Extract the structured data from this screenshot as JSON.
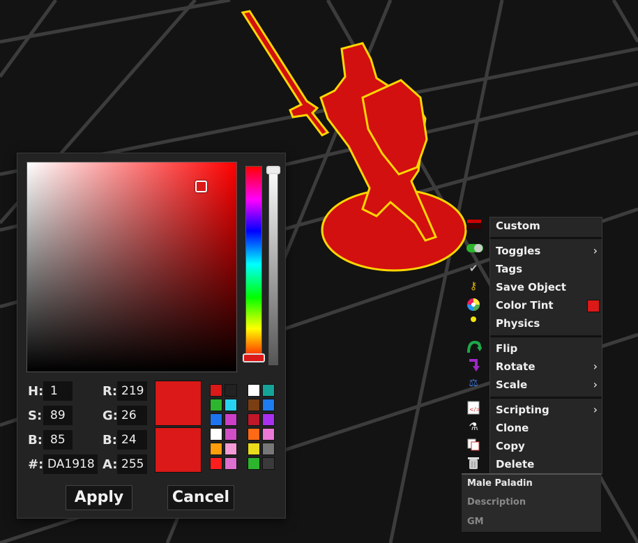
{
  "color_picker": {
    "hsb": {
      "h_label": "H:",
      "h": "1",
      "s_label": "S:",
      "s": "89",
      "b_label": "B:",
      "b": "85"
    },
    "rgb": {
      "r_label": "R:",
      "r": "219",
      "g_label": "G:",
      "g": "26",
      "b_label": "B:",
      "b": "24"
    },
    "hex_label": "#:",
    "hex": "DA1918",
    "alpha_label": "A:",
    "alpha": "255",
    "current_color": "#da1918",
    "apply_label": "Apply",
    "cancel_label": "Cancel",
    "palette_left": [
      "#da1918",
      "#222222",
      "#2db52d",
      "#28d3f0",
      "#1e74ee",
      "#cc3fc8",
      "#ffffff",
      "#d04fc6",
      "#ff9e0c",
      "#f49ad6",
      "#ff1d1d",
      "#dd6fce"
    ],
    "palette_right": [
      "#ffffff",
      "#15a49a",
      "#7b3e13",
      "#1e7bf0",
      "#c0172a",
      "#a930ef",
      "#ff6a17",
      "#ec79d7",
      "#e9dc1d",
      "#777777",
      "#2db52d",
      "#3a3a3a"
    ]
  },
  "context_menu": {
    "items": [
      {
        "label": "Custom",
        "icon": "custom-color-icon"
      },
      {
        "label": "Toggles",
        "icon": "toggle-icon",
        "submenu": true
      },
      {
        "label": "Tags",
        "icon": "check-icon"
      },
      {
        "label": "Save Object",
        "icon": "key-icon"
      },
      {
        "label": "Color Tint",
        "icon": "color-wheel-icon",
        "swatch": "#da1918"
      },
      {
        "label": "Physics",
        "icon": "physics-dot-icon"
      },
      {
        "label": "Flip",
        "icon": "flip-arrow-icon"
      },
      {
        "label": "Rotate",
        "icon": "rotate-arrow-icon",
        "submenu": true
      },
      {
        "label": "Scale",
        "icon": "scale-icon",
        "submenu": true
      },
      {
        "label": "Scripting",
        "icon": "script-file-icon",
        "submenu": true
      },
      {
        "label": "Clone",
        "icon": "flask-icon"
      },
      {
        "label": "Copy",
        "icon": "copy-icon"
      },
      {
        "label": "Delete",
        "icon": "trash-icon"
      }
    ],
    "submenu_arrow": "›"
  },
  "object_info": {
    "name": "Male Paladin",
    "description": "Description",
    "gm": "GM"
  }
}
